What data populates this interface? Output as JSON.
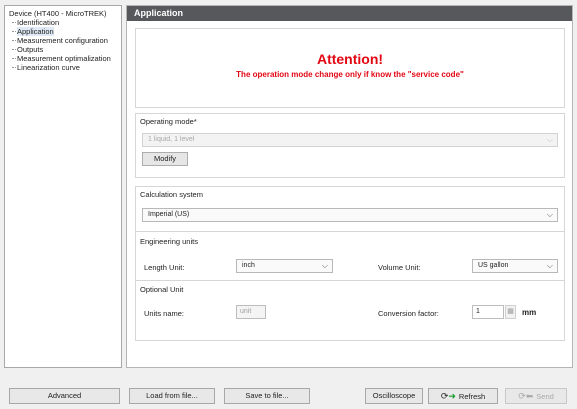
{
  "tree": {
    "root": "Device (HT400 - MicroTREK)",
    "items": [
      {
        "label": "Identification"
      },
      {
        "label": "Application"
      },
      {
        "label": "Measurement configuration"
      },
      {
        "label": "Outputs"
      },
      {
        "label": "Measurement optimalization"
      },
      {
        "label": "Linearization curve"
      }
    ],
    "selected": "Application"
  },
  "header": {
    "title": "Application"
  },
  "attention": {
    "title": "Attention!",
    "text": "The operation mode change only if know the \"service code\"",
    "color": "#e30613"
  },
  "operating_mode": {
    "title": "Operating mode*",
    "value": "1 liquid, 1 level",
    "modify_label": "Modify"
  },
  "calculation": {
    "title": "Calculation system",
    "value": "Imperial (US)"
  },
  "engineering": {
    "title": "Engineering units",
    "length_label": "Length Unit:",
    "length_value": "inch",
    "volume_label": "Volume Unit:",
    "volume_value": "US gallon"
  },
  "optional": {
    "title": "Optional Unit",
    "units_name_label": "Units name:",
    "units_name_placeholder": "unit",
    "conversion_label": "Conversion factor:",
    "conversion_value": "1",
    "conversion_unit": "mm"
  },
  "bottom": {
    "advanced": "Advanced",
    "load": "Load from file...",
    "save": "Save to file...",
    "oscilloscope": "Oscilloscope",
    "refresh": "Refresh",
    "send": "Send"
  },
  "colors": {
    "header_bg": "#56585b",
    "accent_red": "#e30613"
  }
}
